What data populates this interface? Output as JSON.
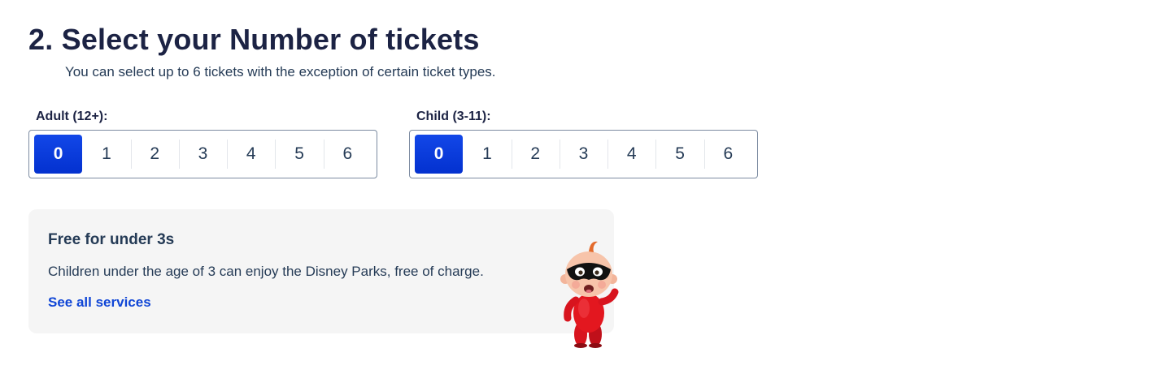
{
  "section": {
    "title": "2. Select your Number of tickets",
    "subtitle": "You can select up to 6 tickets with the exception of certain ticket types."
  },
  "selectors": [
    {
      "label": "Adult (12+):",
      "options": [
        "0",
        "1",
        "2",
        "3",
        "4",
        "5",
        "6"
      ],
      "selected": "0"
    },
    {
      "label": "Child (3-11):",
      "options": [
        "0",
        "1",
        "2",
        "3",
        "4",
        "5",
        "6"
      ],
      "selected": "0"
    }
  ],
  "info_card": {
    "title": "Free for under 3s",
    "text": "Children under the age of 3 can enjoy the Disney Parks, free of charge.",
    "link": "See all services",
    "image": "jack-jack-character-illustration"
  },
  "colors": {
    "selected_bg": "#0a3ce0",
    "link": "#1046d6",
    "card_bg": "#f5f5f5",
    "heading": "#1c2344"
  }
}
